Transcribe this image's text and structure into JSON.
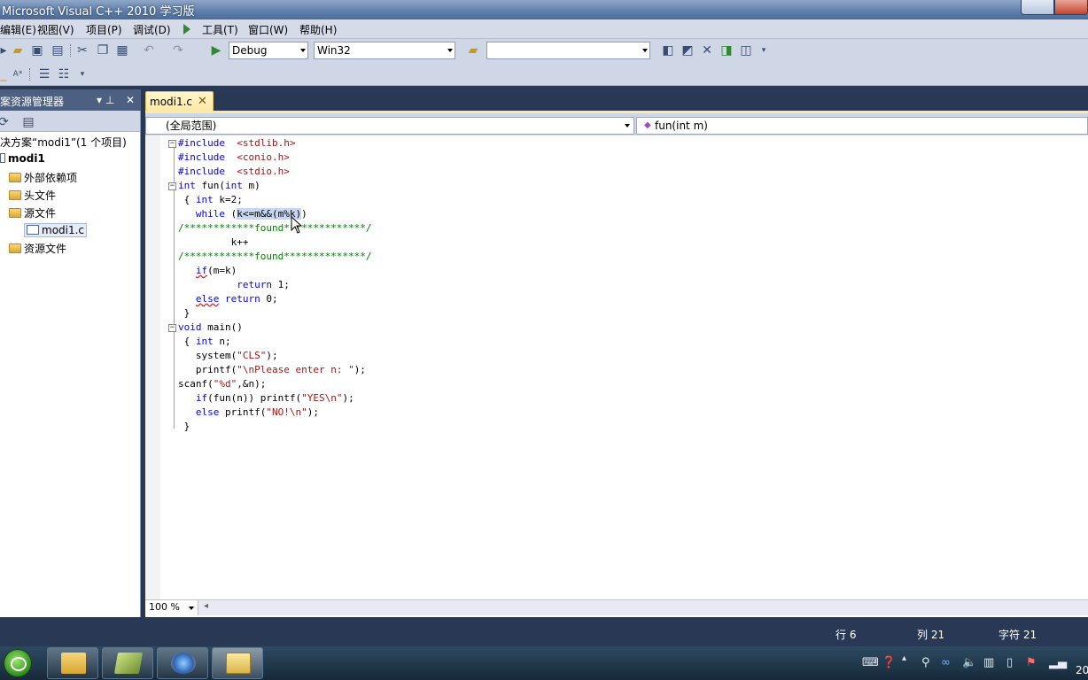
{
  "window": {
    "title": "Microsoft Visual C++ 2010 学习版"
  },
  "menu": {
    "items": [
      "编辑(E)",
      "视图(V)",
      "项目(P)",
      "调试(D)",
      "工具(T)",
      "窗口(W)",
      "帮助(H)"
    ]
  },
  "toolbar": {
    "config_value": "Debug",
    "platform_value": "Win32",
    "find_value": ""
  },
  "solution_explorer": {
    "title": "案资源管理器",
    "pin_glyph": "▾ ⊥",
    "close_glyph": "✕",
    "items": [
      {
        "label": "决方案“modi1”(1 个项目)"
      },
      {
        "label": "modi1"
      },
      {
        "label": "外部依赖项"
      },
      {
        "label": "头文件"
      },
      {
        "label": "源文件"
      },
      {
        "label": "modi1.c"
      },
      {
        "label": "资源文件"
      }
    ]
  },
  "editor": {
    "tab_label": "modi1.c",
    "tab_close": "✕",
    "scope_combo": "(全局范围)",
    "function_combo": "fun(int m)",
    "zoom": "100 %",
    "code": {
      "l1a": "#include",
      "l1b": "  <stdlib.h>",
      "l2a": "#include",
      "l2b": "  <conio.h>",
      "l3a": "#include",
      "l3b": "  <stdio.h>",
      "l4a": "int",
      "l4b": " fun(",
      "l4c": "int",
      "l4d": " m)",
      "l5a": " { ",
      "l5b": "int",
      "l5c": " k=2;",
      "l6a": "   ",
      "l6b": "while",
      "l6c": " (",
      "l6d": "k<=m&&(m%k)",
      "l6e": ")",
      "l7": "/************found**************/",
      "l8": "         k++",
      "l9": "/************found**************/",
      "l10a": "   ",
      "l10b": "if",
      "l10c": "(m=k)",
      "l11a": "          ",
      "l11b": "return",
      "l11c": " 1;",
      "l12a": "   ",
      "l12b": "else",
      "l12c": " ",
      "l12d": "return",
      "l12e": " 0;",
      "l13": " }",
      "l14a": "void",
      "l14b": " main()",
      "l15a": " { ",
      "l15b": "int",
      "l15c": " n;",
      "l16a": "   system(",
      "l16b": "\"CLS\"",
      "l16c": ");",
      "l17a": "   printf(",
      "l17b": "\"\\nPlease enter n: \"",
      "l17c": ");",
      "l18a": "scanf(",
      "l18b": "\"%d\"",
      "l18c": ",&n);",
      "l19a": "   ",
      "l19b": "if",
      "l19c": "(fun(n)) printf(",
      "l19d": "\"YES\\n\"",
      "l19e": ");",
      "l20a": "   ",
      "l20b": "else",
      "l20c": " printf(",
      "l20d": "\"NO!\\n\"",
      "l20e": ");",
      "l21": " }"
    }
  },
  "statusbar": {
    "line": "行 6",
    "col": "列 21",
    "char": "字符 21"
  },
  "taskbar": {
    "clock": "20"
  },
  "colors": {
    "keyword": "#0000ff",
    "string": "#a31515",
    "comment": "#008000",
    "chrome": "#293955"
  }
}
